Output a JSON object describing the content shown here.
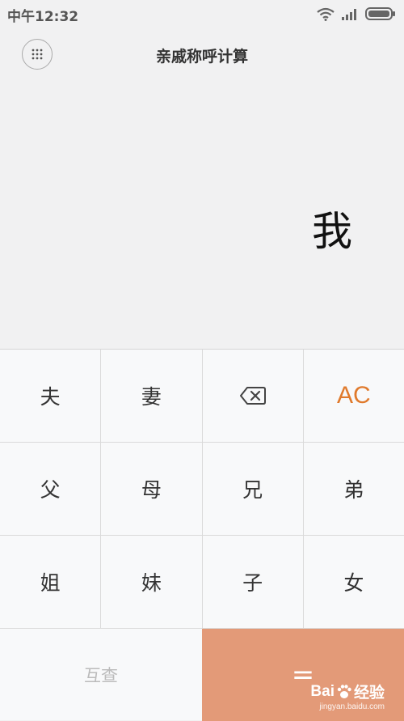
{
  "status_bar": {
    "time": "中午12:32"
  },
  "header": {
    "title": "亲戚称呼计算"
  },
  "display": {
    "result": "我"
  },
  "keypad": {
    "rows": [
      [
        "夫",
        "妻",
        "",
        "AC"
      ],
      [
        "父",
        "母",
        "兄",
        "弟"
      ],
      [
        "姐",
        "妹",
        "子",
        "女"
      ]
    ],
    "mutual_label": "互查",
    "equals_label": "="
  },
  "watermark": {
    "brand_left": "Bai",
    "brand_right": "经验",
    "url": "jingyan.baidu.com"
  },
  "colors": {
    "accent": "#e07a2c",
    "equals_bg": "#e39a78",
    "background": "#f1f1f2"
  }
}
